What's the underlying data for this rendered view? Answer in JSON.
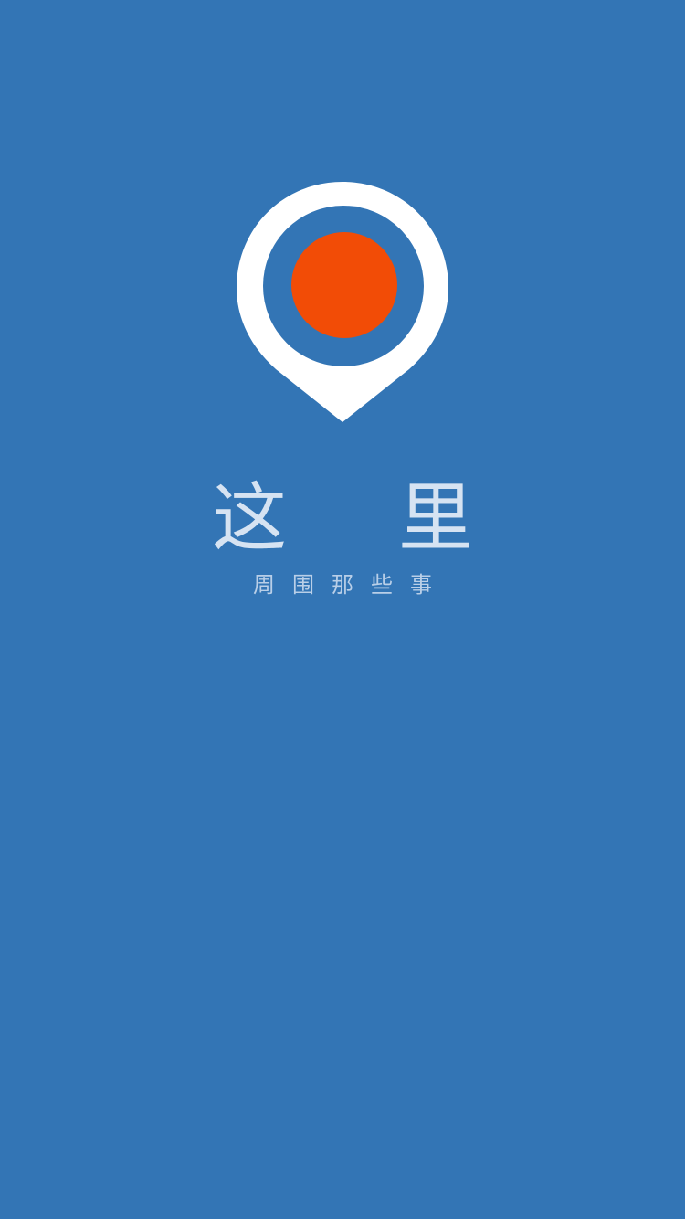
{
  "splash": {
    "app_name": "这 里",
    "tagline": "周围那些事"
  },
  "logo": {
    "icon": "map-pin-icon"
  },
  "colors": {
    "background": "#3375b5",
    "pin_outer": "#ffffff",
    "pin_ring": "#3375b5",
    "pin_center": "#f24c06",
    "title_text": "#d6e3f2",
    "tagline_text": "#b9cfe8"
  }
}
